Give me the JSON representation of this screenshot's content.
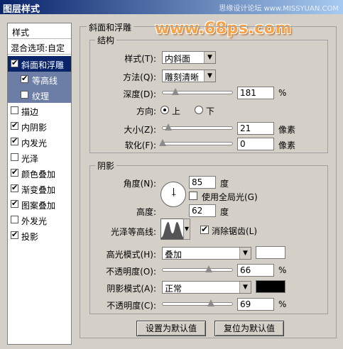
{
  "window": {
    "title": "图层样式",
    "watermark_top": "思缘设计论坛 www.MISSYUAN.COM",
    "watermark_big": "www.68ps.com"
  },
  "sidebar": {
    "header": "样式",
    "blend_options": "混合选项:自定",
    "items": [
      {
        "label": "斜面和浮雕",
        "checked": true
      },
      {
        "label": "等高线",
        "checked": true
      },
      {
        "label": "纹理",
        "checked": false
      },
      {
        "label": "描边",
        "checked": false
      },
      {
        "label": "内阴影",
        "checked": true
      },
      {
        "label": "内发光",
        "checked": true
      },
      {
        "label": "光泽",
        "checked": false
      },
      {
        "label": "颜色叠加",
        "checked": true
      },
      {
        "label": "渐变叠加",
        "checked": true
      },
      {
        "label": "图案叠加",
        "checked": true
      },
      {
        "label": "外发光",
        "checked": false
      },
      {
        "label": "投影",
        "checked": true
      }
    ]
  },
  "bevel": {
    "group_title": "斜面和浮雕",
    "structure_title": "结构",
    "style_label": "样式(T):",
    "style_value": "内斜面",
    "technique_label": "方法(Q):",
    "technique_value": "雕刻清晰",
    "depth_label": "深度(D):",
    "depth_value": "181",
    "depth_fraction": 0.18,
    "depth_unit": "%",
    "direction_label": "方向:",
    "direction_up": "上",
    "direction_down": "下",
    "size_label": "大小(Z):",
    "size_value": "21",
    "size_fraction": 0.08,
    "size_unit": "像素",
    "soften_label": "软化(F):",
    "soften_value": "0",
    "soften_fraction": 0.0,
    "soften_unit": "像素"
  },
  "shading": {
    "group_title": "阴影",
    "angle_label": "角度(N):",
    "angle_value": "85",
    "angle_unit": "度",
    "global_light_label": "使用全局光(G)",
    "altitude_label": "高度:",
    "altitude_value": "62",
    "altitude_unit": "度",
    "gloss_contour_label": "光泽等高线:",
    "antialias_label": "消除锯齿(L)",
    "highlight_mode_label": "高光模式(H):",
    "highlight_mode_value": "叠加",
    "highlight_color": "#ffffff",
    "highlight_opacity_label": "不透明度(O):",
    "highlight_opacity_value": "66",
    "highlight_opacity_fraction": 0.66,
    "highlight_opacity_unit": "%",
    "shadow_mode_label": "阴影模式(A):",
    "shadow_mode_value": "正常",
    "shadow_color": "#000000",
    "shadow_opacity_label": "不透明度(C):",
    "shadow_opacity_value": "69",
    "shadow_opacity_fraction": 0.69,
    "shadow_opacity_unit": "%"
  },
  "buttons": {
    "make_default": "设置为默认值",
    "reset_default": "复位为默认值"
  }
}
